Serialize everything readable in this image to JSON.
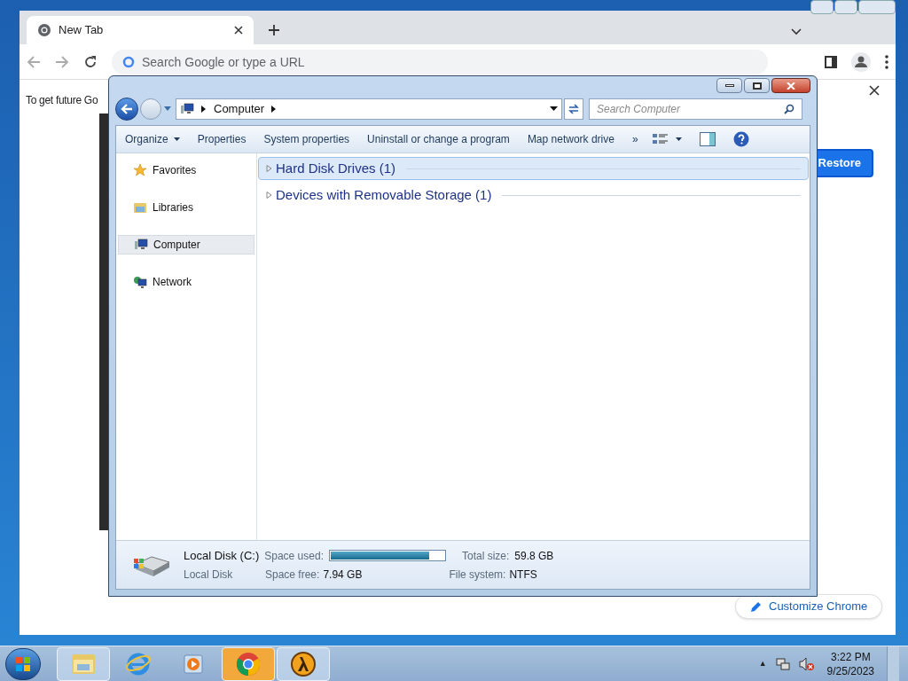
{
  "chrome": {
    "tab": {
      "title": "New Tab"
    },
    "omnibox": {
      "placeholder": "Search Google or type a URL"
    },
    "banner": {
      "text": "To get future Go"
    },
    "restore_button": "Restore",
    "customize_button": "Customize Chrome"
  },
  "explorer": {
    "breadcrumb": [
      "Computer"
    ],
    "search": {
      "placeholder": "Search Computer"
    },
    "toolbar": [
      {
        "label": "Organize",
        "dropdown": true
      },
      {
        "label": "Properties",
        "dropdown": false
      },
      {
        "label": "System properties",
        "dropdown": false
      },
      {
        "label": "Uninstall or change a program",
        "dropdown": false
      },
      {
        "label": "Map network drive",
        "dropdown": false
      },
      {
        "label": "»",
        "dropdown": false
      }
    ],
    "nav": [
      {
        "label": "Favorites",
        "kind": "star",
        "selected": false
      },
      {
        "label": "Libraries",
        "kind": "library",
        "selected": false
      },
      {
        "label": "Computer",
        "kind": "computer",
        "selected": true
      },
      {
        "label": "Network",
        "kind": "network",
        "selected": false
      }
    ],
    "groups": [
      {
        "label": "Hard Disk Drives (1)",
        "expanded": false,
        "selected": true
      },
      {
        "label": "Devices with Removable Storage (1)",
        "expanded": false,
        "selected": false
      }
    ],
    "details": {
      "name": "Local Disk (C:)",
      "type": "Local Disk",
      "used_label": "Space used:",
      "level": 0.87,
      "free_label": "Space free:",
      "free": "7.94 GB",
      "total_label": "Total size:",
      "total": "59.8 GB",
      "fs_label": "File system:",
      "fs": "NTFS"
    }
  },
  "taskbar": {
    "items": [
      {
        "kind": "explorer",
        "running": true,
        "flashing": false
      },
      {
        "kind": "ie",
        "running": false,
        "flashing": false
      },
      {
        "kind": "media",
        "running": false,
        "flashing": false
      },
      {
        "kind": "chrome",
        "running": true,
        "flashing": true
      },
      {
        "kind": "halflife",
        "running": true,
        "flashing": false
      }
    ],
    "tray": {
      "time": "3:22 PM",
      "date": "9/25/2023",
      "expand": "▲"
    }
  }
}
